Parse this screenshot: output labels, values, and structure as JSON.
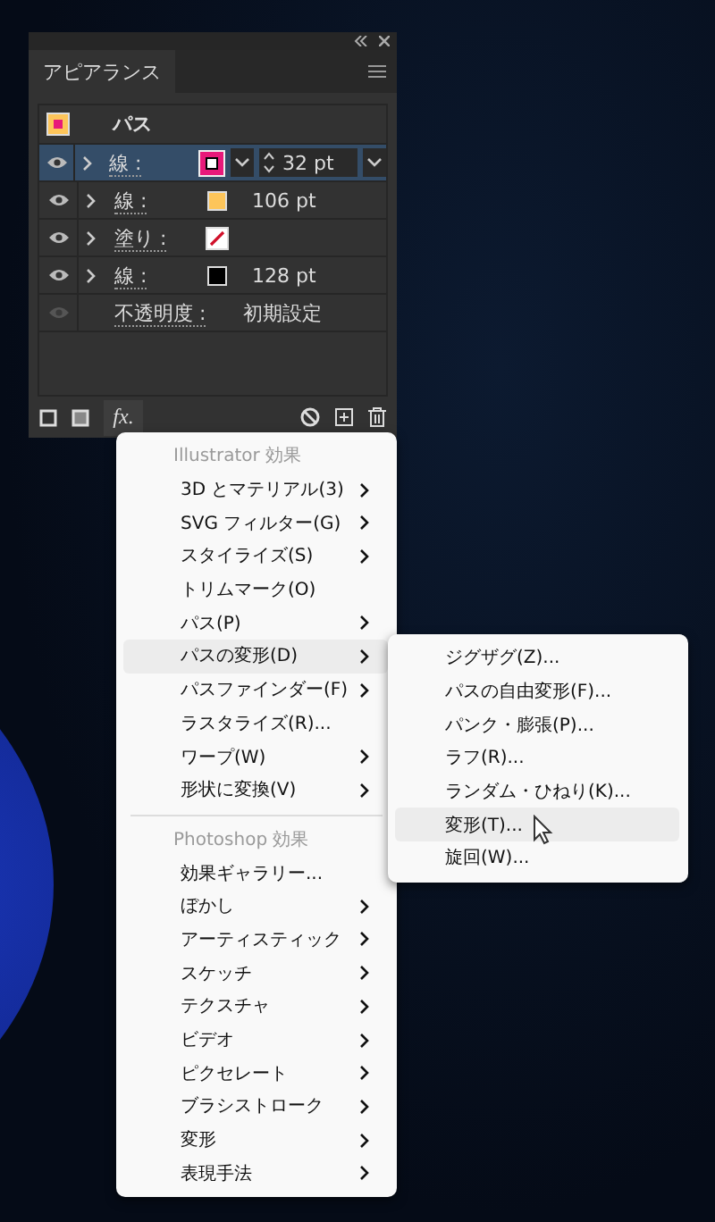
{
  "panel": {
    "tab": "アピアランス",
    "header": {
      "label": "パス"
    },
    "rows": [
      {
        "kind": "stroke",
        "visible": true,
        "selected": true,
        "label": "線 :",
        "color": "#e8197a",
        "value": "32 pt"
      },
      {
        "kind": "stroke",
        "visible": true,
        "selected": false,
        "label": "線 :",
        "color": "#fdc55a",
        "value": "106 pt"
      },
      {
        "kind": "fill",
        "visible": true,
        "selected": false,
        "label": "塗り :"
      },
      {
        "kind": "stroke",
        "visible": true,
        "selected": false,
        "label": "線 :",
        "color": "#000000",
        "value": "128 pt"
      },
      {
        "kind": "opacity",
        "visible": false,
        "selected": false,
        "label": "不透明度 :",
        "value": "初期設定"
      }
    ],
    "effects_button": "fx."
  },
  "menu": {
    "sections": [
      {
        "heading": "Illustrator 効果",
        "items": [
          {
            "label": "3D とマテリアル(3)",
            "submenu": true,
            "selected": false
          },
          {
            "label": "SVG フィルター(G)",
            "submenu": true,
            "selected": false
          },
          {
            "label": "スタイライズ(S)",
            "submenu": true,
            "selected": false
          },
          {
            "label": "トリムマーク(O)",
            "submenu": false,
            "selected": false
          },
          {
            "label": "パス(P)",
            "submenu": true,
            "selected": false
          },
          {
            "label": "パスの変形(D)",
            "submenu": true,
            "selected": true
          },
          {
            "label": "パスファインダー(F)",
            "submenu": true,
            "selected": false
          },
          {
            "label": "ラスタライズ(R)...",
            "submenu": false,
            "selected": false
          },
          {
            "label": "ワープ(W)",
            "submenu": true,
            "selected": false
          },
          {
            "label": "形状に変換(V)",
            "submenu": true,
            "selected": false
          }
        ]
      },
      {
        "heading": "Photoshop 効果",
        "items": [
          {
            "label": "効果ギャラリー...",
            "submenu": false,
            "selected": false
          },
          {
            "label": "ぼかし",
            "submenu": true,
            "selected": false
          },
          {
            "label": "アーティスティック",
            "submenu": true,
            "selected": false
          },
          {
            "label": "スケッチ",
            "submenu": true,
            "selected": false
          },
          {
            "label": "テクスチャ",
            "submenu": true,
            "selected": false
          },
          {
            "label": "ビデオ",
            "submenu": true,
            "selected": false
          },
          {
            "label": "ピクセレート",
            "submenu": true,
            "selected": false
          },
          {
            "label": "ブラシストローク",
            "submenu": true,
            "selected": false
          },
          {
            "label": "変形",
            "submenu": true,
            "selected": false
          },
          {
            "label": "表現手法",
            "submenu": true,
            "selected": false
          }
        ]
      }
    ]
  },
  "submenu": {
    "items": [
      {
        "label": "ジグザグ(Z)...",
        "selected": false
      },
      {
        "label": "パスの自由変形(F)...",
        "selected": false
      },
      {
        "label": "パンク・膨張(P)...",
        "selected": false
      },
      {
        "label": "ラフ(R)...",
        "selected": false
      },
      {
        "label": "ランダム・ひねり(K)...",
        "selected": false
      },
      {
        "label": "変形(T)...",
        "selected": true
      },
      {
        "label": "旋回(W)...",
        "selected": false
      }
    ]
  }
}
